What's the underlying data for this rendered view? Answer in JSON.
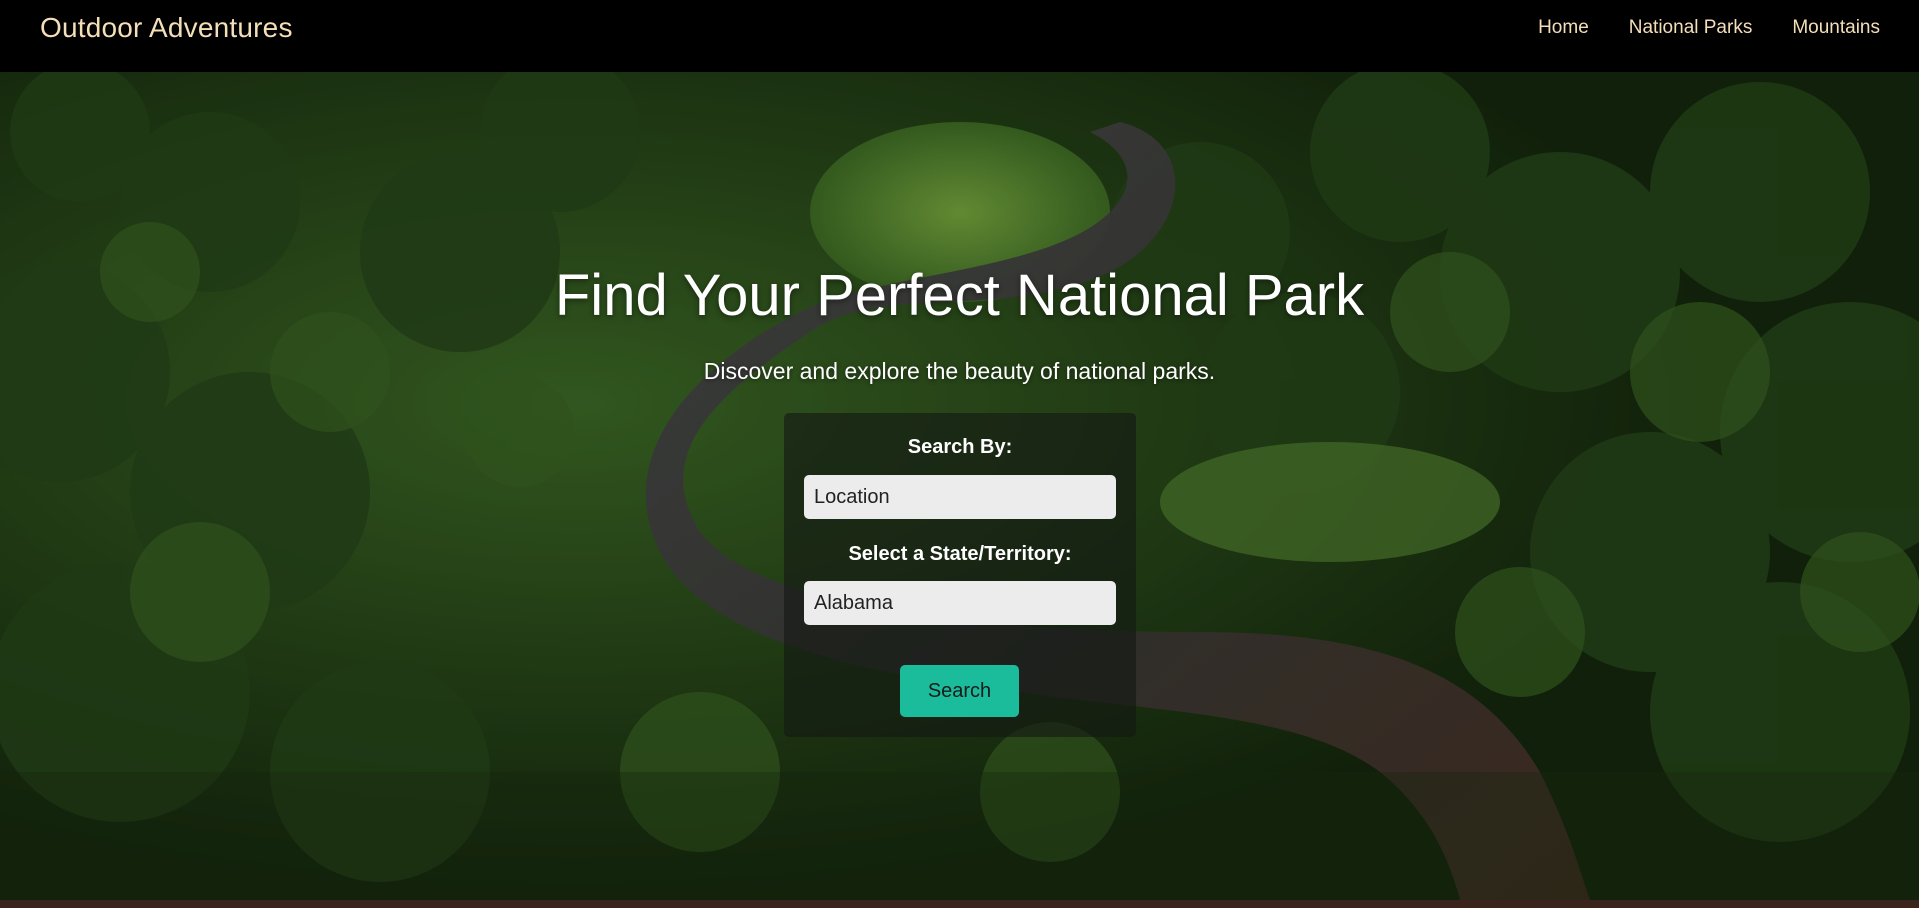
{
  "navbar": {
    "brand": "Outdoor Adventures",
    "links": [
      {
        "label": "Home"
      },
      {
        "label": "National Parks"
      },
      {
        "label": "Mountains"
      }
    ]
  },
  "hero": {
    "title": "Find Your Perfect National Park",
    "subtitle": "Discover and explore the beauty of national parks."
  },
  "search_form": {
    "search_by_label": "Search By:",
    "search_by_value": "Location",
    "state_label": "Select a State/Territory:",
    "state_value": "Alabama",
    "submit_label": "Search"
  },
  "colors": {
    "navbar_bg": "#000000",
    "nav_text": "#f4dfb8",
    "button_accent": "#1abc9c",
    "hero_text": "#ffffff"
  },
  "icons": {
    "hero_image": "forest-river-aerial-photo"
  }
}
